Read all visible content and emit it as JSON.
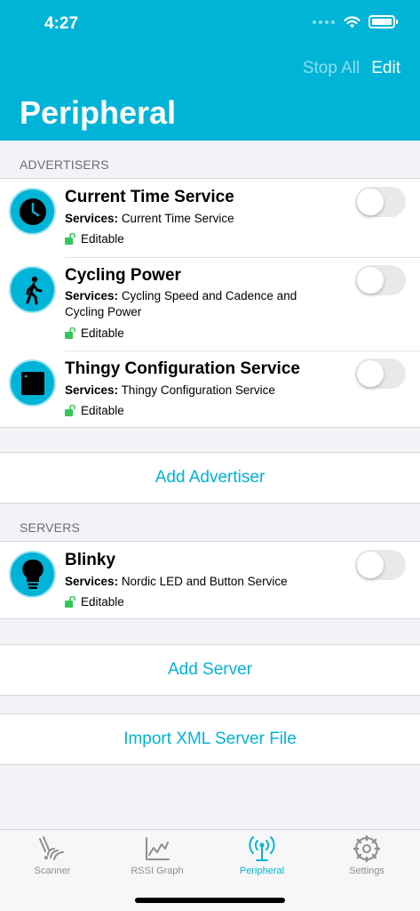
{
  "status_bar": {
    "time": "4:27"
  },
  "nav": {
    "stop_all": "Stop All",
    "edit": "Edit",
    "title": "Peripheral"
  },
  "advertisers": {
    "section_label": "ADVERTISERS",
    "items": [
      {
        "title": "Current Time Service",
        "services_label": "Services:",
        "services": "Current Time Service",
        "editable": "Editable",
        "icon": "clock-icon",
        "enabled": false
      },
      {
        "title": "Cycling Power",
        "services_label": "Services:",
        "services": "Cycling Speed and Cadence and Cycling Power",
        "editable": "Editable",
        "icon": "walking-person-icon",
        "enabled": false
      },
      {
        "title": "Thingy Configuration Service",
        "services_label": "Services:",
        "services": "Thingy Configuration Service",
        "editable": "Editable",
        "icon": "square-icon",
        "enabled": false
      }
    ],
    "add_label": "Add Advertiser"
  },
  "servers": {
    "section_label": "SERVERS",
    "items": [
      {
        "title": "Blinky",
        "services_label": "Services:",
        "services": "Nordic LED and Button Service",
        "editable": "Editable",
        "icon": "light-bulb-icon",
        "enabled": false
      }
    ],
    "add_label": "Add Server",
    "import_label": "Import XML Server File"
  },
  "tabbar": {
    "tabs": [
      {
        "label": "Scanner",
        "icon": "scanner-icon",
        "active": false
      },
      {
        "label": "RSSI Graph",
        "icon": "graph-icon",
        "active": false
      },
      {
        "label": "Peripheral",
        "icon": "antenna-icon",
        "active": true
      },
      {
        "label": "Settings",
        "icon": "gear-icon",
        "active": false
      }
    ]
  },
  "colors": {
    "accent": "#00B4D8",
    "editable_lock": "#34C759",
    "background": "#F2F2F7"
  }
}
